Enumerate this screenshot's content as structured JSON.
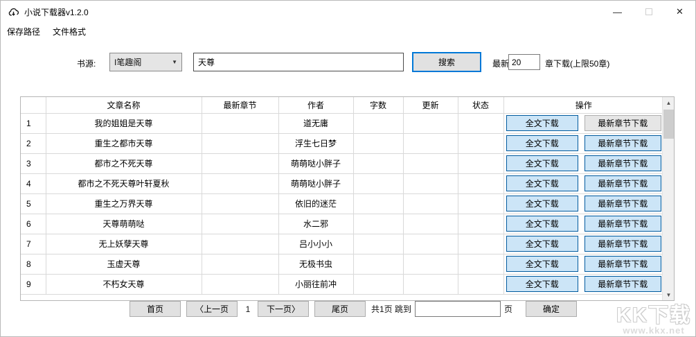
{
  "window": {
    "title": "小说下载器v1.2.0",
    "controls": {
      "minimize_glyph": "—",
      "close_glyph": "✕"
    }
  },
  "menu": {
    "items": [
      {
        "label": "保存路径"
      },
      {
        "label": "文件格式"
      }
    ]
  },
  "search": {
    "source_label": "书源:",
    "source_value": "I笔趣阁",
    "dropdown_arrow": "▼",
    "keyword_value": "天尊",
    "search_button": "搜索",
    "latest_label": "最新",
    "chapter_count": "20",
    "chapter_suffix": "章下载(上限50章)"
  },
  "table": {
    "headers": [
      "文章名称",
      "最新章节",
      "作者",
      "字数",
      "更新",
      "状态",
      "操作"
    ],
    "full_download_label": "全文下载",
    "latest_download_label": "最新章节下载",
    "rows": [
      {
        "index": "1",
        "title": "我的姐姐是天尊",
        "author": "道无庸"
      },
      {
        "index": "2",
        "title": "重生之都市天尊",
        "author": "浮生七日梦"
      },
      {
        "index": "3",
        "title": "都市之不死天尊",
        "author": "萌萌哒小胖子"
      },
      {
        "index": "4",
        "title": "都市之不死天尊叶轩夏秋",
        "author": "萌萌哒小胖子"
      },
      {
        "index": "5",
        "title": "重生之万界天尊",
        "author": "依旧的迷茫"
      },
      {
        "index": "6",
        "title": "天尊萌萌哒",
        "author": "水二邪"
      },
      {
        "index": "7",
        "title": "无上妖孽天尊",
        "author": "吕小小小"
      },
      {
        "index": "8",
        "title": "玉虚天尊",
        "author": "无极书虫"
      },
      {
        "index": "9",
        "title": "不朽女天尊",
        "author": "小丽往前冲"
      }
    ],
    "scrollbar": {
      "up_glyph": "▲",
      "down_glyph": "▼"
    }
  },
  "pagination": {
    "first": "首页",
    "prev": "〈上一页",
    "current_page": "1",
    "next": "下一页〉",
    "last": "尾页",
    "total_jump_label": "共1页 跳到",
    "jump_value": "",
    "page_suffix": "页",
    "confirm": "确定"
  },
  "watermark": {
    "line1": "KK下载",
    "line2": "www.kkx.net"
  },
  "colors": {
    "accent_blue": "#0078d7",
    "download_button_bg": "#cce5f7",
    "download_button_border": "#005a9e",
    "default_button_bg": "#e1e1e1"
  }
}
